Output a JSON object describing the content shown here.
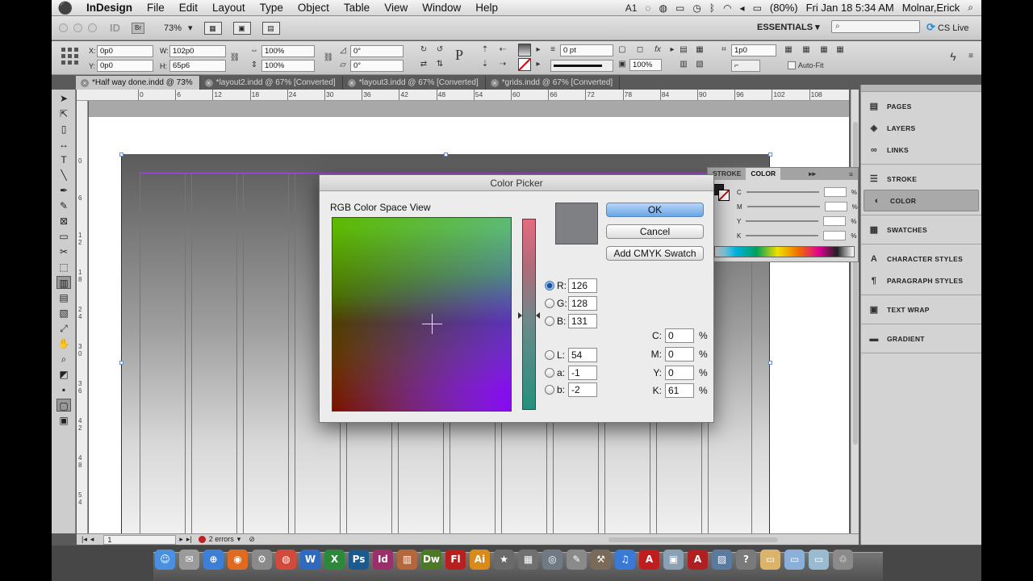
{
  "menubar": {
    "apple": "",
    "app": "InDesign",
    "items": [
      "File",
      "Edit",
      "Layout",
      "Type",
      "Object",
      "Table",
      "View",
      "Window",
      "Help"
    ],
    "ai_badge": "1",
    "battery": "(80%)",
    "clock": "Fri Jan 18  5:34 AM",
    "user": "Molnar,Erick",
    "spotlight": "⌕"
  },
  "appbar": {
    "id_label": "ID",
    "br_label": "Br",
    "zoom": "73%",
    "workspace": "ESSENTIALS ▾",
    "search_placeholder": "",
    "cslive": "CS Live"
  },
  "control": {
    "x_label": "X:",
    "x_value": "0p0",
    "y_label": "Y:",
    "y_value": "0p0",
    "w_label": "W:",
    "w_value": "102p0",
    "h_label": "H:",
    "h_value": "65p6",
    "scale_x": "100%",
    "scale_y": "100%",
    "rotate": "0°",
    "shear": "0°",
    "stroke_weight": "0 pt",
    "opacity": "100%",
    "fit_value": "1p0",
    "autofit_label": "Auto-Fit"
  },
  "tabs": [
    {
      "label": "*Half way done.indd @ 73%",
      "active": true
    },
    {
      "label": "*layout2.indd @ 67% [Converted]",
      "active": false
    },
    {
      "label": "*layout3.indd @ 67% [Converted]",
      "active": false
    },
    {
      "label": "*grids.indd @ 67% [Converted]",
      "active": false
    }
  ],
  "ruler": {
    "h_ticks": [
      "0",
      "6",
      "12",
      "18",
      "24",
      "30",
      "36",
      "42",
      "48",
      "54",
      "60",
      "66",
      "72",
      "78",
      "84",
      "90",
      "96",
      "102",
      "108"
    ],
    "v_ticks": [
      "0",
      "6",
      "1 2",
      "1 8",
      "2 4",
      "3 0",
      "3 6",
      "4 2",
      "4 8",
      "5 4"
    ]
  },
  "status": {
    "page": "1",
    "errors": "2 errors"
  },
  "panels": {
    "groups": [
      [
        {
          "label": "PAGES",
          "icon": "pages-icon",
          "glyph": "▤"
        },
        {
          "label": "LAYERS",
          "icon": "layers-icon",
          "glyph": "◈"
        },
        {
          "label": "LINKS",
          "icon": "links-icon",
          "glyph": "∞"
        }
      ],
      [
        {
          "label": "STROKE",
          "icon": "stroke-icon",
          "glyph": "☰"
        },
        {
          "label": "COLOR",
          "icon": "color-icon",
          "glyph": "◐",
          "selected": true
        }
      ],
      [
        {
          "label": "SWATCHES",
          "icon": "swatches-icon",
          "glyph": "▦"
        }
      ],
      [
        {
          "label": "CHARACTER STYLES",
          "icon": "character-styles-icon",
          "glyph": "A"
        },
        {
          "label": "PARAGRAPH STYLES",
          "icon": "paragraph-styles-icon",
          "glyph": "¶"
        }
      ],
      [
        {
          "label": "TEXT WRAP",
          "icon": "text-wrap-icon",
          "glyph": "▣"
        }
      ],
      [
        {
          "label": "GRADIENT",
          "icon": "gradient-icon",
          "glyph": "▬"
        }
      ]
    ]
  },
  "colorpanel": {
    "tab_stroke": "STROKE",
    "tab_color": "COLOR",
    "rows": [
      {
        "label": "C",
        "pct": "%"
      },
      {
        "label": "M",
        "pct": "%"
      },
      {
        "label": "Y",
        "pct": "%"
      },
      {
        "label": "K",
        "pct": "%"
      }
    ]
  },
  "picker": {
    "title": "Color Picker",
    "space_label": "RGB Color Space View",
    "swatch_color": "#7e8083",
    "ok": "OK",
    "cancel": "Cancel",
    "add_swatch": "Add CMYK Swatch",
    "rgb": [
      {
        "label": "R:",
        "value": "126",
        "selected": true
      },
      {
        "label": "G:",
        "value": "128",
        "selected": false
      },
      {
        "label": "B:",
        "value": "131",
        "selected": false
      }
    ],
    "lab": [
      {
        "label": "L:",
        "value": "54"
      },
      {
        "label": "a:",
        "value": "-1"
      },
      {
        "label": "b:",
        "value": "-2"
      }
    ],
    "cmyk": [
      {
        "label": "C:",
        "value": "0",
        "pct": "%"
      },
      {
        "label": "M:",
        "value": "0",
        "pct": "%"
      },
      {
        "label": "Y:",
        "value": "0",
        "pct": "%"
      },
      {
        "label": "K:",
        "value": "61",
        "pct": "%"
      }
    ]
  },
  "dock": {
    "apps": [
      {
        "name": "finder-app",
        "glyph": "☺",
        "color": "#4a8fe0"
      },
      {
        "name": "preview-app",
        "glyph": "✉",
        "color": "#9b9b9b"
      },
      {
        "name": "safari-app",
        "glyph": "⊕",
        "color": "#3d7fd6"
      },
      {
        "name": "firefox-app",
        "glyph": "◉",
        "color": "#e06a20"
      },
      {
        "name": "system-prefs-app",
        "glyph": "⚙",
        "color": "#8a8a8a"
      },
      {
        "name": "chrome-app",
        "glyph": "◍",
        "color": "#d24a3a"
      },
      {
        "name": "word-app",
        "glyph": "W",
        "color": "#2e6bc0"
      },
      {
        "name": "excel-app",
        "glyph": "X",
        "color": "#2a8a3a"
      },
      {
        "name": "photoshop-app",
        "glyph": "Ps",
        "color": "#1b5a8f"
      },
      {
        "name": "indesign-app",
        "glyph": "Id",
        "color": "#9c2f6b"
      },
      {
        "name": "books-app",
        "glyph": "▥",
        "color": "#b5663a"
      },
      {
        "name": "dreamweaver-app",
        "glyph": "Dw",
        "color": "#4c7a24"
      },
      {
        "name": "flash-app",
        "glyph": "Fl",
        "color": "#b82020"
      },
      {
        "name": "illustrator-app",
        "glyph": "Ai",
        "color": "#d98a18"
      },
      {
        "name": "star-app",
        "glyph": "★",
        "color": "#6a6a6a"
      },
      {
        "name": "calculator-app",
        "glyph": "▦",
        "color": "#707070"
      },
      {
        "name": "utility-app",
        "glyph": "◎",
        "color": "#6f7a85"
      },
      {
        "name": "script-app",
        "glyph": "✎",
        "color": "#8a8a8a"
      },
      {
        "name": "automator-app",
        "glyph": "⚒",
        "color": "#7a6a5a"
      },
      {
        "name": "itunes-app",
        "glyph": "♫",
        "color": "#3a7ad6"
      },
      {
        "name": "acrobat-app",
        "glyph": "A",
        "color": "#c01e1e"
      },
      {
        "name": "installer-app",
        "glyph": "▣",
        "color": "#8aa0b5"
      },
      {
        "name": "pdf-app",
        "glyph": "A",
        "color": "#b02020"
      },
      {
        "name": "photos-app",
        "glyph": "▨",
        "color": "#5a7aa0"
      },
      {
        "name": "help-app",
        "glyph": "?",
        "color": "#7a7a7a"
      },
      {
        "name": "folder-app",
        "glyph": "▭",
        "color": "#d9b46a"
      },
      {
        "name": "documents-app",
        "glyph": "▭",
        "color": "#8ab0d9"
      },
      {
        "name": "downloads-app",
        "glyph": "▭",
        "color": "#9abad0"
      },
      {
        "name": "trash-app",
        "glyph": "♲",
        "color": "#8a8a8a"
      }
    ]
  }
}
